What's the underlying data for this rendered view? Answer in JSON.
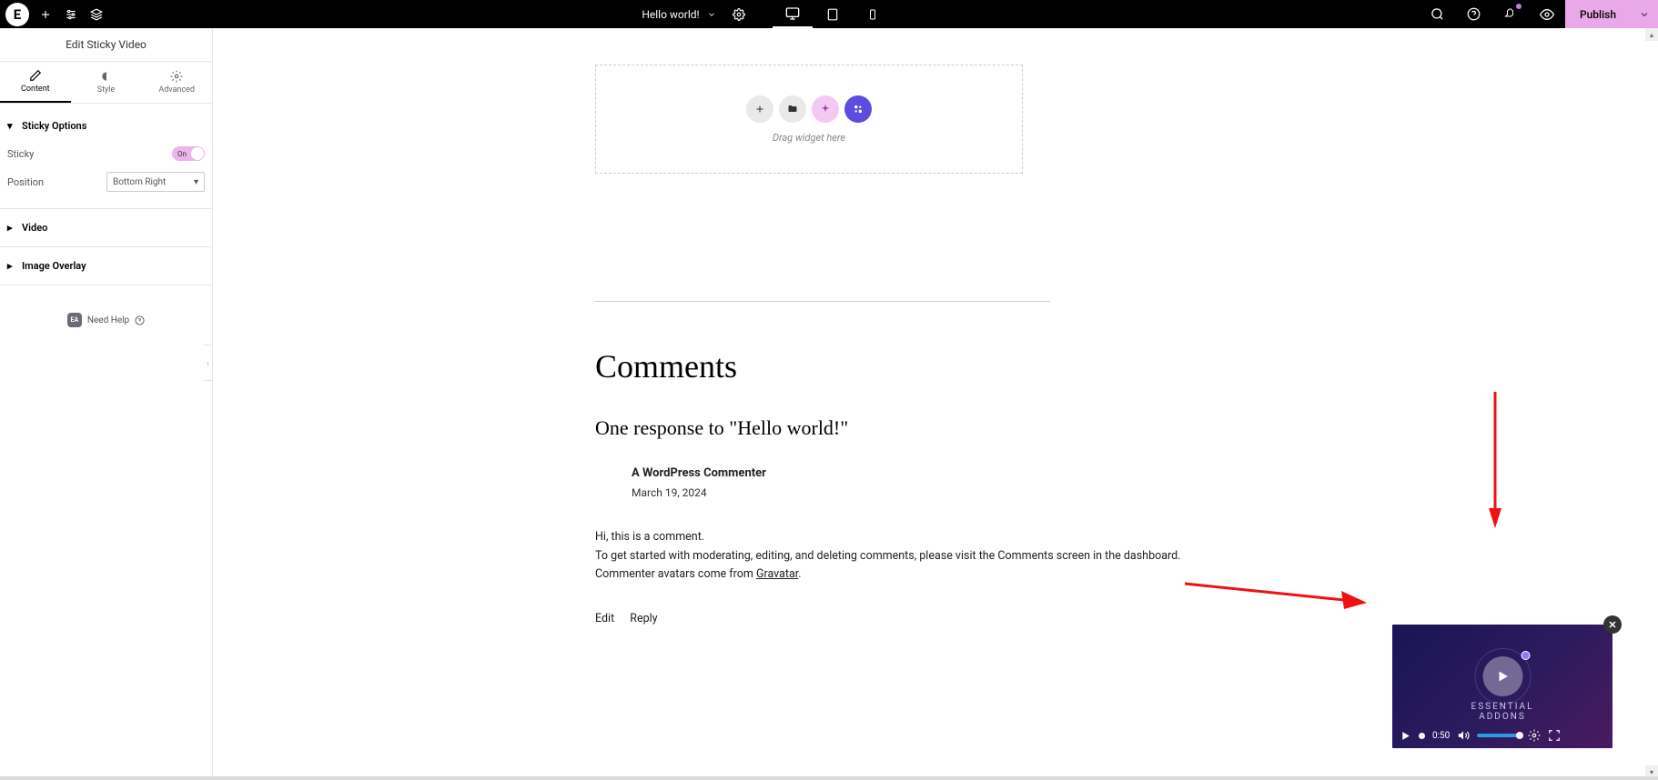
{
  "topbar": {
    "logo_letter": "E",
    "page_title": "Hello world!",
    "publish_label": "Publish"
  },
  "sidebar": {
    "header_title": "Edit Sticky Video",
    "tabs": {
      "content": "Content",
      "style": "Style",
      "advanced": "Advanced"
    },
    "sticky_options": {
      "title": "Sticky Options",
      "sticky_label": "Sticky",
      "sticky_value": "On",
      "position_label": "Position",
      "position_value": "Bottom Right"
    },
    "video_section": "Video",
    "image_overlay_section": "Image Overlay",
    "need_help_badge": "EA",
    "need_help_label": "Need Help"
  },
  "canvas": {
    "drop_hint": "Drag widget here",
    "comments_title": "Comments",
    "response_title": "One response to \"Hello world!\"",
    "commenter_name": "A WordPress Commenter",
    "comment_date": "March 19, 2024",
    "comment_line1": "Hi, this is a comment.",
    "comment_line2": "To get started with moderating, editing, and deleting comments, please visit the Comments screen in the dashboard.",
    "comment_line3_prefix": "Commenter avatars come from ",
    "comment_line3_link": "Gravatar",
    "edit_label": "Edit",
    "reply_label": "Reply"
  },
  "sticky_video": {
    "brand": "ESSENTIAL ADDONS",
    "time": "0:50"
  },
  "colors": {
    "publish_bg": "#e9a8e8",
    "purple_btn": "#5c4ce0",
    "arrow": "#e11"
  }
}
